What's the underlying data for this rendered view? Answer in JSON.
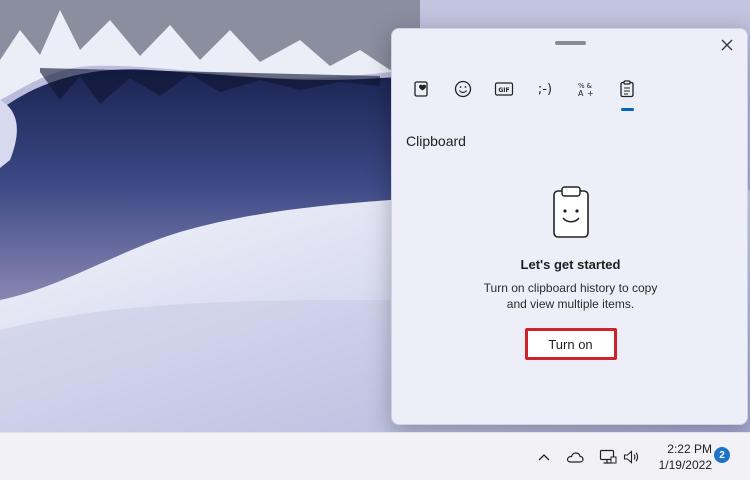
{
  "flyout": {
    "tabs": [
      {
        "icon": "favorites-heart-icon",
        "active": false
      },
      {
        "icon": "emoji-icon",
        "active": false
      },
      {
        "icon": "gif-icon",
        "label": "GIF",
        "active": false
      },
      {
        "icon": "kaomoji-icon",
        "label": ";-)",
        "active": false
      },
      {
        "icon": "symbols-icon",
        "active": false
      },
      {
        "icon": "clipboard-icon",
        "active": true
      }
    ],
    "section_title": "Clipboard",
    "empty_state": {
      "icon": "clipboard-smile-icon",
      "heading": "Let's get started",
      "description": "Turn on clipboard history to copy and view multiple items.",
      "button_label": "Turn on",
      "button_highlight_color": "#d0202a"
    },
    "close_icon": "close-icon",
    "accent_color": "#0067c0"
  },
  "taskbar": {
    "tray_icons": [
      "chevron-up-icon",
      "onedrive-cloud-icon",
      "network-icon",
      "volume-icon"
    ],
    "time": "2:22 PM",
    "date": "1/19/2022",
    "notification_count": "2",
    "badge_color": "#1e73c8"
  }
}
